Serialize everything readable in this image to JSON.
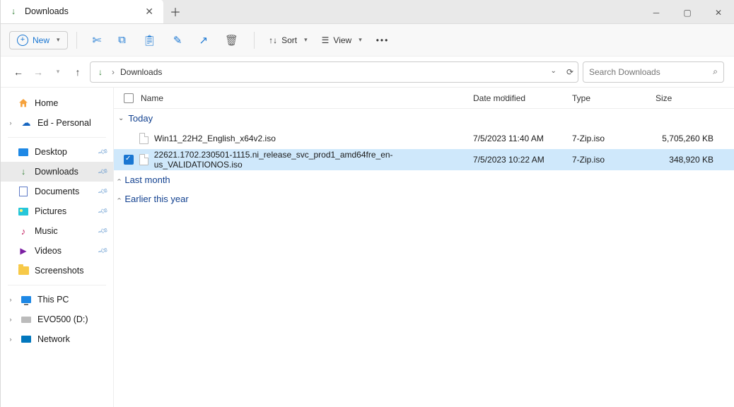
{
  "tab": {
    "title": "Downloads"
  },
  "toolbar": {
    "new": "New",
    "sort": "Sort",
    "view": "View"
  },
  "address": {
    "location": "Downloads",
    "sep": "›"
  },
  "search": {
    "placeholder": "Search Downloads"
  },
  "sidebar": {
    "home": "Home",
    "personal": "Ed - Personal",
    "pinned": [
      {
        "label": "Desktop"
      },
      {
        "label": "Downloads"
      },
      {
        "label": "Documents"
      },
      {
        "label": "Pictures"
      },
      {
        "label": "Music"
      },
      {
        "label": "Videos"
      },
      {
        "label": "Screenshots"
      }
    ],
    "thispc": "This PC",
    "evo": "EVO500 (D:)",
    "network": "Network"
  },
  "columns": {
    "name": "Name",
    "date": "Date modified",
    "type": "Type",
    "size": "Size"
  },
  "groups": {
    "today": "Today",
    "lastmonth": "Last month",
    "earlier": "Earlier this year"
  },
  "files": [
    {
      "name": "Win11_22H2_English_x64v2.iso",
      "date": "7/5/2023 11:40 AM",
      "type": "7-Zip.iso",
      "size": "5,705,260 KB",
      "selected": false
    },
    {
      "name": "22621.1702.230501-1115.ni_release_svc_prod1_amd64fre_en-us_VALIDATIONOS.iso",
      "date": "7/5/2023 10:22 AM",
      "type": "7-Zip.iso",
      "size": "348,920 KB",
      "selected": true
    }
  ]
}
